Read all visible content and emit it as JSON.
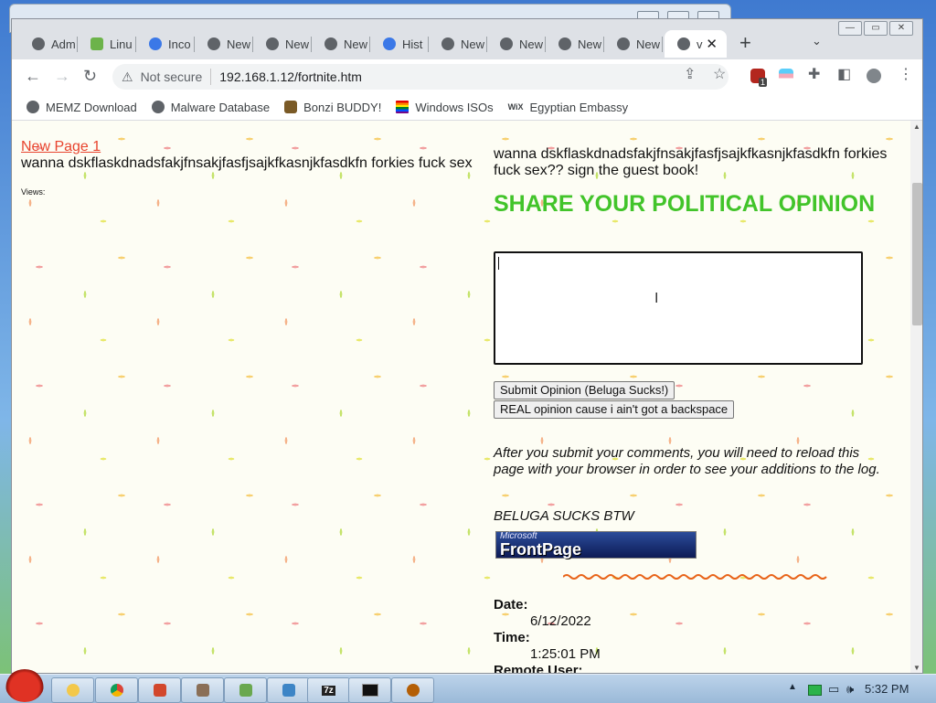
{
  "tabs": [
    {
      "label": "Adm",
      "color": "#5f6368"
    },
    {
      "label": "Linu",
      "color": "#6cb34a"
    },
    {
      "label": "Inco",
      "color": "#3b78e7"
    },
    {
      "label": "New",
      "color": "#5f6368"
    },
    {
      "label": "New",
      "color": "#5f6368"
    },
    {
      "label": "New",
      "color": "#5f6368"
    },
    {
      "label": "Hist",
      "color": "#3b78e7"
    },
    {
      "label": "New",
      "color": "#5f6368"
    },
    {
      "label": "New",
      "color": "#5f6368"
    },
    {
      "label": "New",
      "color": "#5f6368"
    },
    {
      "label": "New",
      "color": "#5f6368"
    },
    {
      "label": "v",
      "color": "#5f6368",
      "active": true
    }
  ],
  "toolbar": {
    "not_secure": "Not secure",
    "url": "192.168.1.12/fortnite.htm",
    "badge": "1"
  },
  "bookmarks": [
    {
      "label": "MEMZ Download",
      "icon": "globe-icon"
    },
    {
      "label": "Malware Database",
      "icon": "globe-icon"
    },
    {
      "label": "Bonzi BUDDY!",
      "icon": "bonzi-icon"
    },
    {
      "label": "Windows ISOs",
      "icon": "rainbow-flag-icon"
    },
    {
      "label": "Egyptian Embassy",
      "icon": "wix-icon"
    }
  ],
  "page": {
    "link": "New Page 1",
    "left_text": "wanna dskflaskdnadsfakjfnsakjfasfjsajkfkasnjkfasdkfn forkies fuck sex",
    "views": "Views:",
    "right_text": "wanna dskflaskdnadsfakjfnsakjfasfjsajkfkasnjkfasdkfn forkies fuck sex?? sign the guest book!",
    "heading": "SHARE YOUR POLITICAL OPINION",
    "submit_label": "Submit Opinion (Beluga Sucks!)",
    "real_label": "REAL opinion cause i ain't got a backspace",
    "note": "After you submit your comments, you will need to reload this page with your browser in order to see your additions to the log.",
    "beluga": "BELUGA SUCKS BTW",
    "fp_small": "Microsoft",
    "fp_big": "FrontPage",
    "date_label": "Date:",
    "date_value": "6/12/2022",
    "time_label": "Time:",
    "time_value": "1:25:01 PM",
    "remote_label": "Remote User:"
  },
  "tray": {
    "time": "5:32 PM"
  },
  "colors": {
    "heading": "#42c42a",
    "link": "#e8442e"
  }
}
